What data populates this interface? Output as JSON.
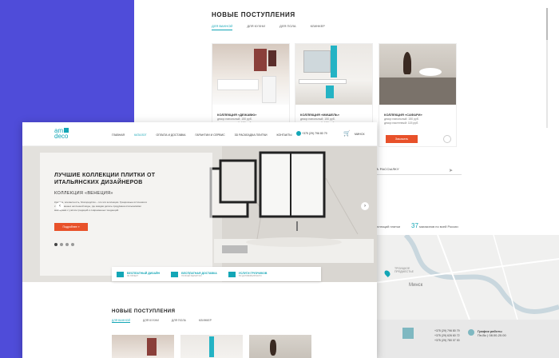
{
  "back": {
    "title": "НОВЫЕ ПОСТУПЛЕНИЯ",
    "tabs": [
      "ДЛЯ ВАННОЙ",
      "ДЛЯ КУХНИ",
      "ДЛЯ ПОЛА",
      "КЛИНКЕР"
    ],
    "cards": [
      {
        "caption": "КОЛЛЕКЦИЯ «ДЕЖАВЮ»",
        "line1": "декор напольный: 150 руб.",
        "line2": "декор настенный: 150 руб."
      },
      {
        "caption": "КОЛЛЕКЦИЯ «МИШЕЛЬ»",
        "line1": "декор напольный: 150 руб.",
        "line2": "декор настенный: 150 руб."
      },
      {
        "caption": "КОЛЛЕКЦИЯ «САФАРИ»",
        "line1": "декор напольный: 150 руб.",
        "line2": "декор настенный: 115 руб."
      }
    ],
    "order_label": "Заказать",
    "newsletter": "НА РАССЫЛКУ",
    "stats": [
      {
        "value": "",
        "label": "коллекций плитки"
      },
      {
        "value": "37",
        "label": "магазинов по всей России"
      }
    ],
    "map_labels": [
      "ТРОИЦКОЕ ПРЕДМЕСТЬЕ",
      "Минск"
    ],
    "footer": {
      "phones": [
        "+375 (29) 796 80 79",
        "+375 (29) 626 60 72",
        "+375 (29) 780 07 00"
      ],
      "hours_title": "График работы",
      "hours": "Пн-Вс | 08.00-20.00"
    }
  },
  "front": {
    "logo_top": "am",
    "logo_bottom": "deco",
    "menu": [
      "ГЛАВНАЯ",
      "КАТАЛОГ",
      "ОПЛАТА И ДОСТАВКА",
      "ГАРАНТИИ И СЕРВИС",
      "3D РАСКЛАДКА ПЛИТКИ",
      "КОНТАКТЫ"
    ],
    "phone": "+375 (29) 796 80 79",
    "city": "МИНСК",
    "hero": {
      "title": "ЛУЧШИЕ КОЛЛЕКЦИИ ПЛИТКИ ОТ ИТАЛЬЯНСКИХ ДИЗАЙНЕРОВ",
      "subtitle": "КОЛЛЕКЦИЯ «ВЕНЕЦИЯ»",
      "text": "Красота, элегантность, благородство – это эти коллекции. Грациозные источники в стилизованных нетленной моды, где каждая деталь продумана итальянскими мастерами с учётом традиций и современных тенденций.",
      "button": "Подробнее »"
    },
    "features": [
      {
        "title": "БЕСПЛАТНЫЙ ДИЗАЙН",
        "sub": "3D-ПРОЕКТ"
      },
      {
        "title": "БЕСПЛАТНАЯ ДОСТАВКА",
        "sub": "ПО ВСЕЙ БЕЛАРУСИ"
      },
      {
        "title": "УСЛУГИ ГРУЗЧИКОВ",
        "sub": "ПО ДОГОВОРЕННОСТИ"
      }
    ],
    "news_title": "НОВЫЕ ПОСТУПЛЕНИЯ",
    "news_tabs": [
      "ДЛЯ ВАННОЙ",
      "ДЛЯ КУХНИ",
      "ДЛЯ ПОЛА",
      "КЛИНКЕР"
    ]
  },
  "colors": {
    "accent": "#13a6b6",
    "cta": "#e8512a",
    "background": "#4f4cd9"
  }
}
